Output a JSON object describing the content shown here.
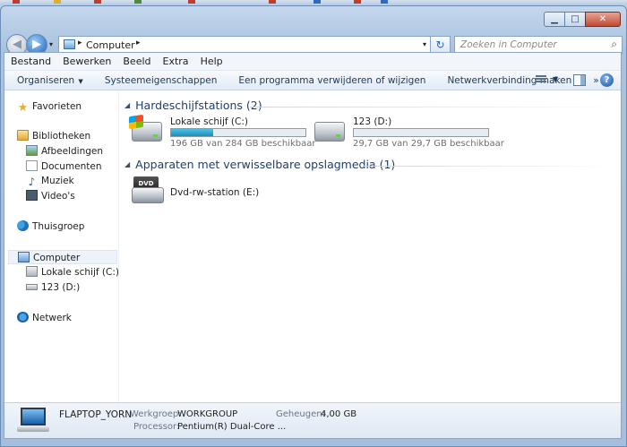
{
  "window": {
    "caption_buttons": {
      "minimize": "▁",
      "maximize": "□",
      "close": "✕"
    }
  },
  "address": {
    "crumb": "Computer",
    "separator": "▸",
    "dropdown": "▾",
    "search_placeholder": "Zoeken in Computer",
    "refresh": "↻"
  },
  "menu": {
    "items": [
      "Bestand",
      "Bewerken",
      "Beeld",
      "Extra",
      "Help"
    ]
  },
  "commandbar": {
    "organize": "Organiseren",
    "system_properties": "Systeemeigenschappen",
    "uninstall": "Een programma verwijderen of wijzigen",
    "map_network": "Netwerkverbinding maken",
    "more": "»",
    "help": "?"
  },
  "navigation": {
    "favorites": "Favorieten",
    "libraries": "Bibliotheken",
    "pictures": "Afbeeldingen",
    "documents": "Documenten",
    "music": "Muziek",
    "videos": "Video's",
    "homegroup": "Thuisgroep",
    "computer": "Computer",
    "local_disk": "Lokale schijf (C:)",
    "drive_d": "123 (D:)",
    "network": "Netwerk"
  },
  "content": {
    "hard_drives_header": "Hardeschijfstations (2)",
    "removable_header": "Apparaten met verwisselbare opslagmedia (1)",
    "drives": [
      {
        "name": "Lokale schijf (C:)",
        "space": "196 GB van 284 GB beschikbaar",
        "used_fraction": 0.31
      },
      {
        "name": "123 (D:)",
        "space": "29,7 GB van 29,7 GB beschikbaar",
        "used_fraction": 0.0
      }
    ],
    "dvd": {
      "name": "Dvd-rw-station (E:)",
      "badge": "DVD"
    }
  },
  "details": {
    "computer_name": "FLAPTOP_YORN",
    "workgroup_label": "Werkgroep:",
    "workgroup_value": "WORKGROUP",
    "memory_label": "Geheugen:",
    "memory_value": "4,00 GB",
    "processor_label": "Processor:",
    "processor_value": "Pentium(R) Dual-Core ..."
  }
}
